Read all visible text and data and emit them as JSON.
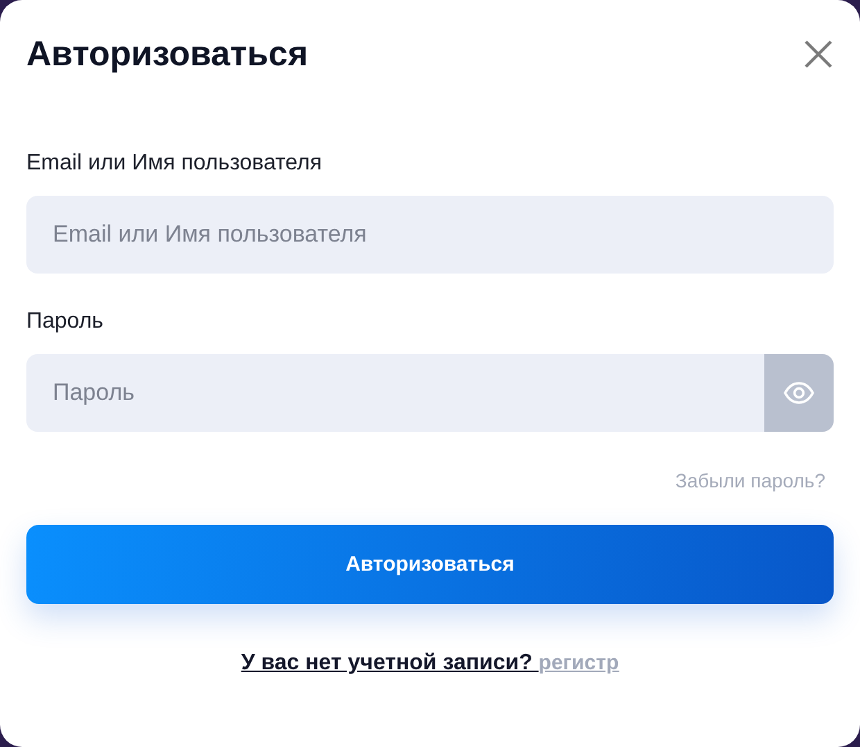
{
  "dialog": {
    "title": "Авторизоваться"
  },
  "fields": [
    {
      "kind": "text",
      "label": "Email или Имя пользователя",
      "placeholder": "Email или Имя пользователя"
    },
    {
      "kind": "password",
      "label": "Пароль",
      "placeholder": "Пароль"
    }
  ],
  "forgot_link": "Забыли пароль?",
  "submit_button": "Авторизоваться",
  "signup": {
    "prompt": "У вас нет учетной записи? ",
    "link": "регистр"
  }
}
